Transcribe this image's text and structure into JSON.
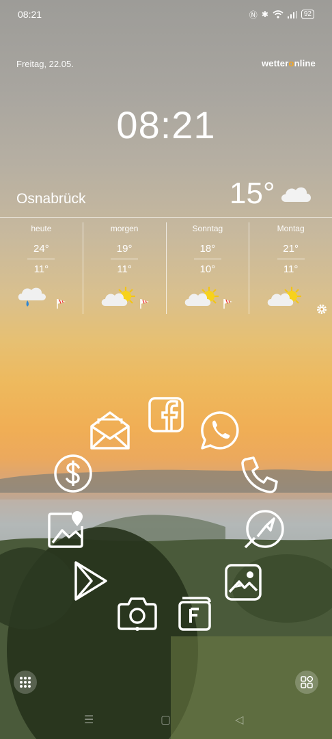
{
  "status_bar": {
    "time": "08:21",
    "battery": "92"
  },
  "widget": {
    "date": "Freitag, 22.05.",
    "brand_prefix": "wetter",
    "brand_suffix": "nline",
    "clock": "08:21",
    "city": "Osnabrück",
    "current_temp": "15°",
    "current_icon": "cloud-icon",
    "forecast": [
      {
        "day": "heute",
        "high": "24°",
        "low": "11°",
        "icon": "cloud-rain-icon"
      },
      {
        "day": "morgen",
        "high": "19°",
        "low": "11°",
        "icon": "sun-cloud-icon"
      },
      {
        "day": "Sonntag",
        "high": "18°",
        "low": "10°",
        "icon": "sun-cloud-icon"
      },
      {
        "day": "Montag",
        "high": "21°",
        "low": "11°",
        "icon": "sun-cloud-icon"
      }
    ],
    "accent_color": "#f5a623"
  },
  "apps": [
    {
      "name": "Facebook",
      "icon": "facebook-icon"
    },
    {
      "name": "WhatsApp",
      "icon": "whatsapp-icon"
    },
    {
      "name": "Phone",
      "icon": "phone-icon"
    },
    {
      "name": "Browser",
      "icon": "compass-icon"
    },
    {
      "name": "Gallery",
      "icon": "gallery-icon"
    },
    {
      "name": "Files",
      "icon": "files-icon"
    },
    {
      "name": "Camera",
      "icon": "camera-icon"
    },
    {
      "name": "Play Store",
      "icon": "play-store-icon"
    },
    {
      "name": "Maps/Photos",
      "icon": "image-pin-icon"
    },
    {
      "name": "Wallet",
      "icon": "dollar-icon"
    },
    {
      "name": "Mail",
      "icon": "mail-icon"
    }
  ]
}
